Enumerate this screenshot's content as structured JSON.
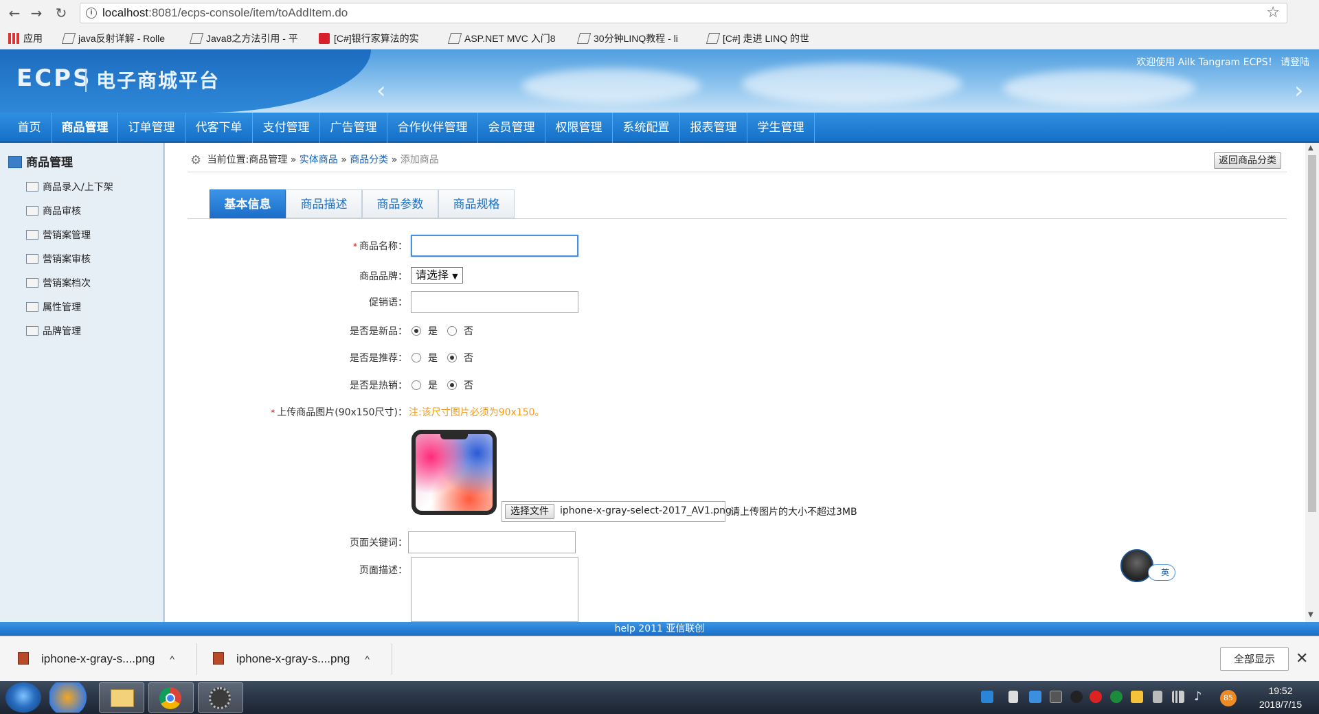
{
  "browser": {
    "url_host": "localhost",
    "url_rest": ":8081/ecps-console/item/toAddItem.do",
    "bookmarks": [
      "应用",
      "java反射详解 - Rolle",
      "Java8之方法引用 - 平",
      "[C#]银行家算法的实",
      "ASP.NET MVC 入门8",
      "30分钟LINQ教程 - li",
      "[C#] 走进 LINQ 的世"
    ]
  },
  "header": {
    "logo_en": "ECPS",
    "logo_cn": "电子商城平台",
    "welcome": "欢迎使用 Ailk Tangram ECPS！ 请登陆"
  },
  "main_nav": [
    "首页",
    "商品管理",
    "订单管理",
    "代客下单",
    "支付管理",
    "广告管理",
    "合作伙伴管理",
    "会员管理",
    "权限管理",
    "系统配置",
    "报表管理",
    "学生管理"
  ],
  "sidebar": {
    "title": "商品管理",
    "items": [
      "商品录入/上下架",
      "商品审核",
      "营销案管理",
      "营销案审核",
      "营销案档次",
      "属性管理",
      "品牌管理"
    ]
  },
  "breadcrumb": {
    "prefix": "当前位置:商品管理",
    "sep": "»",
    "link1": "实体商品",
    "link2": "商品分类",
    "current": "添加商品"
  },
  "back_button": "返回商品分类",
  "tabs": [
    "基本信息",
    "商品描述",
    "商品参数",
    "商品规格"
  ],
  "form": {
    "name_label": "商品名称：",
    "brand_label": "商品品牌：",
    "brand_selected": "请选择",
    "promo_label": "促销语：",
    "is_new_label": "是否是新品：",
    "is_recommend_label": "是否是推荐：",
    "is_hot_label": "是否是热销：",
    "yes": "是",
    "no": "否",
    "upload_label": "上传商品图片(90x150尺寸)：",
    "upload_hint": "注:该尺寸图片必须为90x150。",
    "file_button": "选择文件",
    "file_name": "iphone-x-gray-select-2017_AV1.png",
    "file_note": "请上传图片的大小不超过3MB",
    "keywords_label": "页面关键词：",
    "desc_label": "页面描述："
  },
  "ime_label": "英",
  "footer": "help 2011 亚信联创",
  "downloads": {
    "items": [
      "iphone-x-gray-s....png",
      "iphone-x-gray-s....png"
    ],
    "show_all": "全部显示"
  },
  "taskbar": {
    "badge": "85",
    "time": "19:52",
    "date": "2018/7/15"
  }
}
